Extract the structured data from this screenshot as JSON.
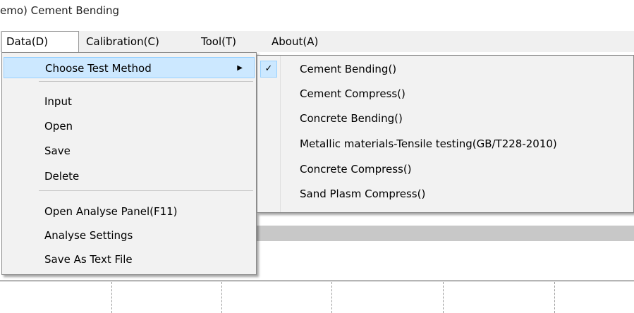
{
  "window": {
    "title": "emo) Cement Bending"
  },
  "menubar": {
    "items": [
      {
        "label": "Data(D)"
      },
      {
        "label": "Calibration(C)"
      },
      {
        "label": "Tool(T)"
      },
      {
        "label": "About(A)"
      }
    ]
  },
  "data_menu": {
    "items": [
      {
        "label": "Choose Test Method",
        "submenu_arrow": "▶"
      },
      {
        "label": "Input"
      },
      {
        "label": "Open"
      },
      {
        "label": "Save"
      },
      {
        "label": "Delete"
      },
      {
        "label": "Open Analyse Panel(F11)"
      },
      {
        "label": "Analyse Settings"
      },
      {
        "label": "Save As Text File"
      }
    ]
  },
  "test_method_submenu": {
    "checkmark": "✓",
    "items": [
      {
        "label": "Cement Bending()",
        "checked": true
      },
      {
        "label": "Cement Compress()"
      },
      {
        "label": "Concrete Bending()"
      },
      {
        "label": "Metallic materials-Tensile testing(GB/T228-2010)"
      },
      {
        "label": "Concrete Compress()"
      },
      {
        "label": "Sand Plasm Compress()"
      }
    ]
  },
  "colors": {
    "menu_bg": "#f2f2f2",
    "highlight": "#cce8ff",
    "highlight_border": "#99d1ff",
    "menubar_bg": "#f0f0f0"
  },
  "icons": {
    "submenu_arrow": "chevron-right-icon",
    "check": "check-icon"
  }
}
